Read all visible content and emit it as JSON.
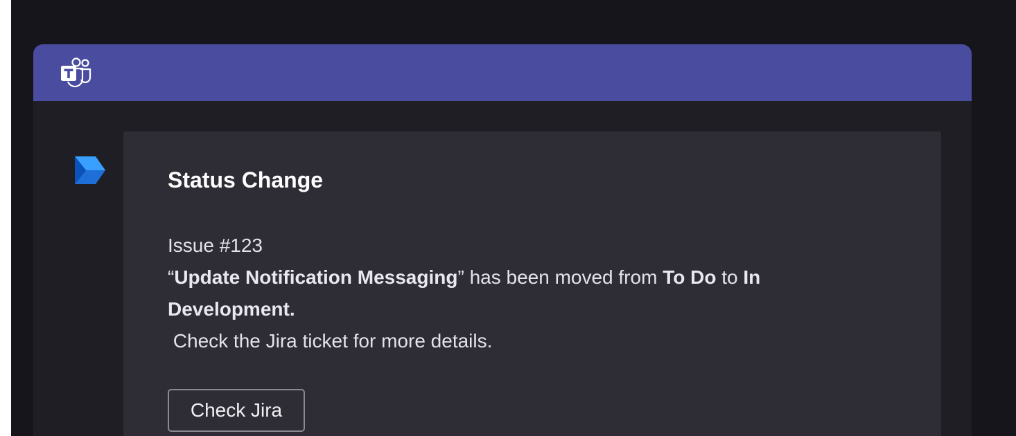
{
  "app": {
    "header_icon": "microsoft-teams-icon",
    "header_color": "#4a4c9f",
    "background_color": "#17151c"
  },
  "sender": {
    "icon": "power-automate-icon",
    "icon_color": "#2c8ff0"
  },
  "card": {
    "title": "Status Change",
    "issue_line": "Issue #123",
    "quote_open": "“",
    "issue_name": "Update Notification Messaging",
    "quote_close": "”",
    "moved_text": " has been moved from ",
    "from_status": "To Do",
    "to_text": " to ",
    "to_status_first": "In",
    "to_status_second": "Development.",
    "details_line": " Check the Jira ticket for more details.",
    "button_label": "Check Jira"
  }
}
